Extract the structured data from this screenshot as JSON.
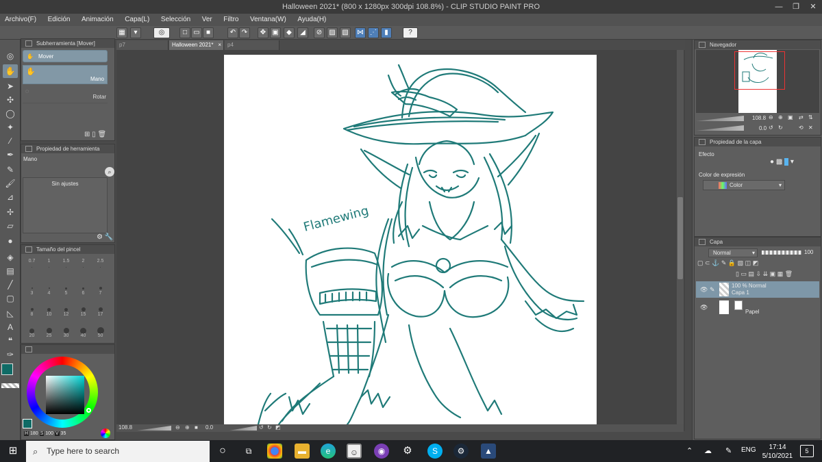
{
  "window": {
    "title": "Halloween 2021* (800 x 1280px 300dpi 108.8%) - CLIP STUDIO PAINT PRO",
    "controls": [
      "—",
      "❐",
      "✕"
    ]
  },
  "menu": [
    "Archivo(F)",
    "Edición",
    "Animación",
    "Capa(L)",
    "Selección",
    "Ver",
    "Filtro",
    "Ventana(W)",
    "Ayuda(H)"
  ],
  "subtool": {
    "header": "Subherramienta [Mover]",
    "group": "Mover",
    "items": [
      "Mano",
      "Rotar"
    ]
  },
  "tool_property": {
    "header": "Propiedad de herramienta",
    "tool_name": "Mano",
    "empty_label": "Sin ajustes"
  },
  "brush_size": {
    "header": "Tamaño del pincel",
    "sizes": [
      "0.7",
      "1",
      "1.5",
      "2",
      "2.5",
      "3",
      "4",
      "5",
      "6",
      "7",
      "8",
      "10",
      "12",
      "15",
      "17",
      "20",
      "25",
      "30",
      "40",
      "50"
    ]
  },
  "color": {
    "main": "#0f6b66",
    "sub": "#ffffff",
    "h": "180",
    "s": "100",
    "v": "35",
    "h_label": "H",
    "s_label": "S",
    "v_label": "V"
  },
  "tabs": [
    "p7",
    "Halloween 2021*",
    "p4"
  ],
  "canvas": {
    "drawing_text": "Flamewing",
    "stroke_color": "#1f7a78"
  },
  "status": {
    "zoom": "108.8",
    "rotation": "0.0"
  },
  "navigator": {
    "header": "Navegador",
    "zoom": "108.8",
    "rotation": "0.0"
  },
  "layer_property": {
    "header": "Propiedad de la capa",
    "effect_label": "Efecto",
    "expression_label": "Color de expresión",
    "expression_value": "Color"
  },
  "layers": {
    "header": "Capa",
    "blend_mode": "Normal",
    "opacity": "100",
    "items": [
      {
        "info": "100 % Normal",
        "name": "Capa 1"
      },
      {
        "info": "",
        "name": "Papel"
      }
    ]
  },
  "taskbar": {
    "search_placeholder": "Type here to search",
    "language": "ENG",
    "time": "17:14",
    "date": "5/10/2021",
    "notification_count": "5"
  }
}
